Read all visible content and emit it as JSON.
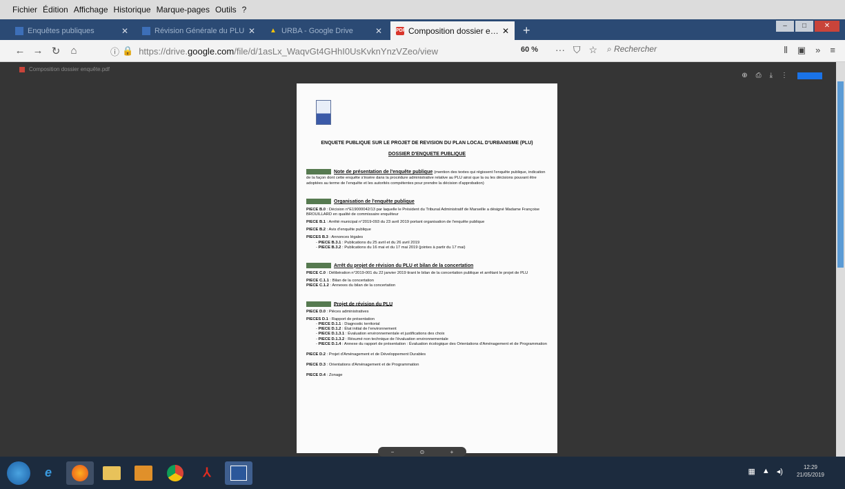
{
  "menu": [
    "Fichier",
    "Édition",
    "Affichage",
    "Historique",
    "Marque-pages",
    "Outils",
    "?"
  ],
  "tabs": [
    {
      "label": "Enquêtes publiques",
      "icon": "site-icon"
    },
    {
      "label": "Révision Générale du PLU",
      "icon": "site-icon"
    },
    {
      "label": "URBA - Google Drive",
      "icon": "drive-icon"
    },
    {
      "label": "Composition dossier enquêt...",
      "icon": "pdf-icon",
      "pdf_badge": "PDF",
      "active": true
    }
  ],
  "url": {
    "prefix": "https://drive.",
    "domain": "google.com",
    "path": "/file/d/1asLx_WaqvGt4GHhI0UsKvknYnzVZeo/view"
  },
  "zoom": "60 %",
  "search_placeholder": "Rechercher",
  "viewer": {
    "filename": "Composition dossier enquête.pdf"
  },
  "doc": {
    "title": "ENQUETE PUBLIQUE SUR LE PROJET DE REVISION DU PLAN LOCAL D'URBANISME (PLU)",
    "subtitle": "DOSSIER D'ENQUETE PUBLIQUE",
    "sec_a": {
      "badge": "PIECE A",
      "head": "Note de présentation de l'enquête publique",
      "body": "(mention des textes qui régissent l'enquête publique, indication de la façon dont cette enquête s'insère dans la procédure administrative relative au PLU ainsi que la ou les décisions pouvant être adoptées au terme de l'enquête et les autorités compétentes pour prendre la décision d'approbation)"
    },
    "sec_b": {
      "badge": "PIECE B",
      "head": "Organisation de l'enquête publique",
      "p0_label": "PIECE B.0",
      "p0": " : Décision n°E19000042/13 par laquelle le Président du Tribunal Administratif de Marseille a désigné Madame Françoise BROUILLARD en qualité de commissaire enquêteur",
      "p1_label": "PIECE B.1",
      "p1": " : Arrêté municipal n°2019-093 du 23 avril 2019 portant organisation de l'enquête publique",
      "p2_label": "PIECE B.2",
      "p2": " : Avis d'enquête publique",
      "p3_label": "PIECES B.3",
      "p3": " : Annonces légales",
      "li1_label": "PIECE B.3.1",
      "li1": " : Publications du 25 avril et du 26 avril 2019",
      "li2_label": "PIECE B.3.2",
      "li2": " : Publications du 16 mai et du 17 mai 2019 (jointes à partir du 17 mai)"
    },
    "sec_c": {
      "badge": "PIECE C",
      "head": "Arrêt du projet de révision du PLU et bilan de la concertation",
      "p0_label": "PIECE C.0",
      "p0": " : Délibération n°2019-001 du 22 janvier 2019 tirant le bilan de la concertation publique et arrêtant le projet de PLU",
      "p1_label": "PIECE C.1.1",
      "p1": " : Bilan de la concertation",
      "p2_label": "PIECE C.1.2",
      "p2": " : Annexes du bilan de la concertation"
    },
    "sec_d": {
      "badge": "PIECE D",
      "head": "Projet de révision du PLU",
      "p0_label": "PIECE D.0",
      "p0": " : Pièces administratives",
      "p1_label": "PIECES D.1",
      "p1": " : Rapport de présentation",
      "li1_label": "PIECE D.1.1",
      "li1": " : Diagnostic territorial",
      "li2_label": "PIECE D.1.2",
      "li2": " : État initial de l'environnement",
      "li3_label": "PIECE D.1.3.1",
      "li3": " : Évaluation environnementale et justifications des choix",
      "li4_label": "PIECE D.1.3.2",
      "li4": " : Résumé non technique de l'évaluation environnementale",
      "li5_label": "PIECE D.1.4",
      "li5": " : Annexe du rapport de présentation : Évaluation écologique des Orientations d'Aménagement et de Programmation",
      "p2_label": "PIECE D.2",
      "p2": " : Projet d'Aménagement et de Développement Durables",
      "p3_label": "PIECE D.3",
      "p3": " : Orientations d'Aménagement et de Programmation",
      "p4_label": "PIECE D.4",
      "p4": " : Zonage"
    }
  },
  "clock": {
    "time": "12:29",
    "date": "21/05/2019"
  }
}
